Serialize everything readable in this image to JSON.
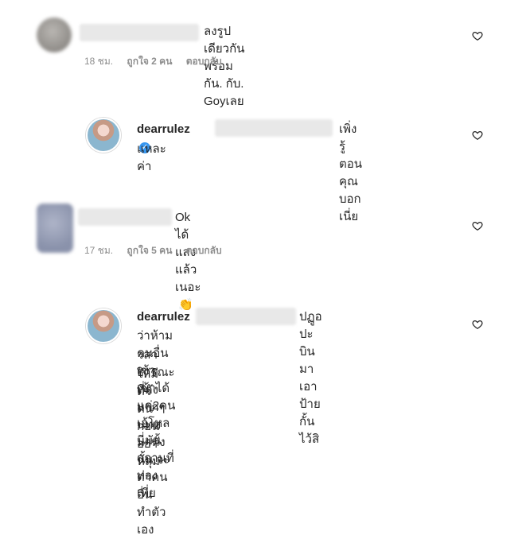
{
  "comments": [
    {
      "text": "ลงรูปเดียวกันพร้อมกัน. กับ. Goyเลย",
      "time": "18 ชม.",
      "likes": "ถูกใจ 2 คน",
      "reply": "ตอบกลับ"
    },
    {
      "username": "dearrulez",
      "text": "เพิ่งรู้ตอนคุณบอกเนี่ย",
      "text2": "แหละค่า"
    },
    {
      "text": "Ok ได้แสงแล้วเนอะ",
      "emoji": "👏",
      "time": "17 ชม.",
      "likes": "ถูกใจ 5 คน",
      "reply": "ตอบกลับ"
    },
    {
      "username": "dearrulez",
      "text": "ปฏูอ ปะ บินมาเอาป้ายกั้นไว้สิ",
      "text2": "ว่าห้ามคนอื่นเข้า เข้าได้แค่2คน เอ้โหลนี่มันสถานที่ท่องเที่ย",
      "text3": "วสาธารณะที่ดังมากๆ นทท มาทั้งนั้น จะด่าคนอื่นทำตัวเอง",
      "text4": "ให้มีตัวตนก่อน อย่าหลุม"
    }
  ],
  "icons": {
    "heart": "heart-outline-icon",
    "verified": "verified-badge-icon"
  },
  "colors": {
    "text": "#262626",
    "meta": "#8e8e8e",
    "verified": "#3897f0"
  }
}
